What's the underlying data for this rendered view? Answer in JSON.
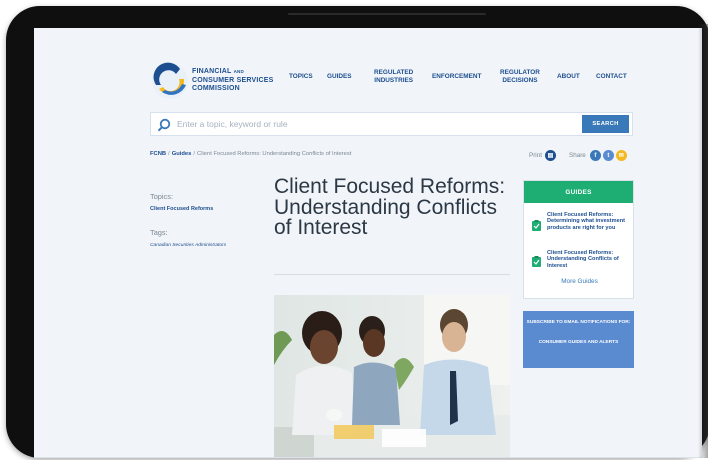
{
  "org": {
    "line1_main": "FINANCIAL",
    "line1_small": "AND",
    "line2": "CONSUMER SERVICES",
    "line3": "COMMISSION"
  },
  "nav": {
    "topics": "TOPICS",
    "guides": "GUIDES",
    "regulated_1": "REGULATED",
    "regulated_2": "INDUSTRIES",
    "enforcement": "ENFORCEMENT",
    "regulator_1": "REGULATOR",
    "regulator_2": "DECISIONS",
    "about": "ABOUT",
    "contact": "CONTACT"
  },
  "search": {
    "placeholder": "Enter a topic, keyword or rule",
    "value": "",
    "button": "SEARCH"
  },
  "breadcrumb": {
    "root": "FCNB",
    "sep": "/",
    "section": "Guides",
    "current": "Client Focused Reforms: Understanding Conflicts of Interest"
  },
  "util": {
    "print": "Print",
    "share": "Share"
  },
  "sidebar": {
    "topics_label": "Topics:",
    "topic_link": "Client Focused Reforms",
    "tags_label": "Tags:",
    "tag_link": "Canadian Securities Administrators"
  },
  "article": {
    "title": "Client Focused Reforms: Understanding Conflicts of Interest"
  },
  "guides_box": {
    "heading": "GUIDES",
    "items": [
      "Client Focused Reforms: Determining what investment products are right for you",
      "Client Focused Reforms: Understanding Conflicts of Interest"
    ],
    "more": "More Guides"
  },
  "subscribe": {
    "line1": "SUBSCRIBE TO EMAIL NOTIFICATIONS FOR:",
    "line2": "CONSUMER GUIDES AND ALERTS"
  },
  "colors": {
    "brand_blue": "#1d4e8f",
    "accent_green": "#1eae74",
    "search_button": "#3a79b9",
    "subscribe_bg": "#5a8bd0",
    "logo_yellow": "#f5b920"
  },
  "icons": [
    "search-icon",
    "print-icon",
    "facebook-icon",
    "twitter-icon",
    "email-icon",
    "checklist-icon"
  ]
}
